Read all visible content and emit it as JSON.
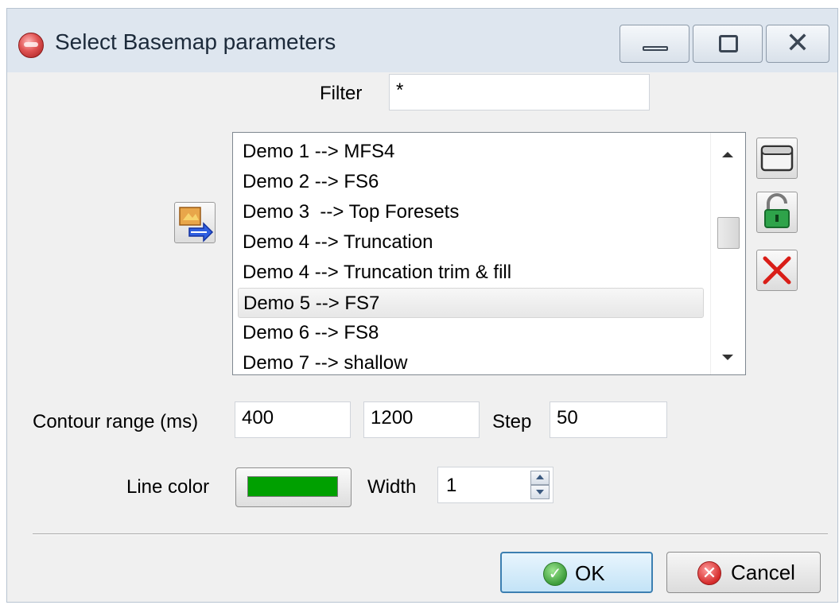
{
  "window": {
    "title": "Select Basemap parameters",
    "icons": {
      "app": "app-icon",
      "minimize": "minimize-icon",
      "maximize": "maximize-icon",
      "close": "close-icon"
    },
    "close_glyph": "✕"
  },
  "filter": {
    "label": "Filter",
    "value": "*"
  },
  "basemap_list": {
    "items": [
      "Demo 1 --> MFS4",
      "Demo 2 --> FS6",
      "Demo 3  --> Top Foresets",
      "Demo 4 --> Truncation",
      "Demo 4 --> Truncation trim & fill",
      "Demo 5 --> FS7",
      "Demo 6 --> FS8",
      "Demo 7 --> shallow"
    ],
    "selected": "Demo 5 --> FS7"
  },
  "side_buttons": {
    "icons": [
      "window-icon",
      "unlock-icon",
      "delete-icon"
    ]
  },
  "import_button": {
    "icon": "import-arrow-icon"
  },
  "contour": {
    "label": "Contour range (ms)",
    "min": "400",
    "max": "1200",
    "step_label": "Step",
    "step": "50"
  },
  "line": {
    "color_label": "Line color",
    "color": "#00a000",
    "width_label": "Width",
    "width": "1"
  },
  "buttons": {
    "ok": "OK",
    "cancel": "Cancel",
    "ok_icon": "check-icon",
    "cancel_icon": "cancel-x-icon",
    "ok_glyph": "✓",
    "cancel_glyph": "✕"
  }
}
